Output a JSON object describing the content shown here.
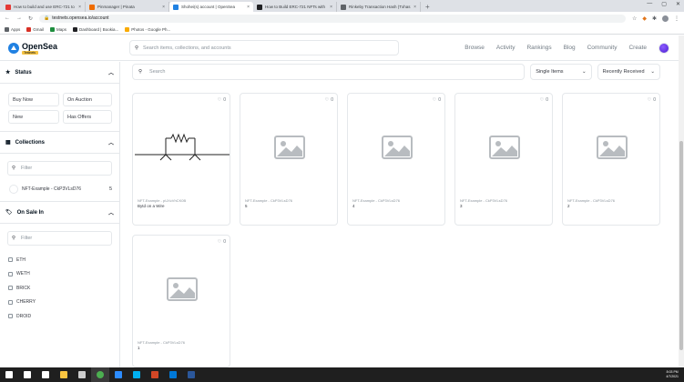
{
  "browser": {
    "tabs": [
      {
        "title": "How to build and use ERC-721 to",
        "color": "#e53935"
      },
      {
        "title": "Pinmanager | Pinata",
        "color": "#ef6c00"
      },
      {
        "title": "Shohei(s) account | OpenSea",
        "color": "#2081e2",
        "active": true
      },
      {
        "title": "How to Build ERC-721 NFTs with",
        "color": "#202124"
      },
      {
        "title": "Rinkeby Transaction Hash (Txhas",
        "color": "#5f6368"
      }
    ],
    "new_tab": "+",
    "url": "testnets.opensea.io/account",
    "bookmarks": [
      {
        "label": "Apps",
        "color": "#5f6368"
      },
      {
        "label": "Gmail",
        "color": "#d93025"
      },
      {
        "label": "Maps",
        "color": "#1e8e3e"
      },
      {
        "label": "Dashboard | Bookia...",
        "color": "#202124"
      },
      {
        "label": "Photos - Google Ph...",
        "color": "#f9ab00"
      }
    ]
  },
  "header": {
    "logo_name": "OpenSea",
    "logo_badge": "Testnets",
    "search_placeholder": "Search items, collections, and accounts",
    "nav": [
      "Browse",
      "Activity",
      "Rankings",
      "Blog",
      "Community",
      "Create"
    ]
  },
  "sidebar": {
    "status": {
      "title": "Status",
      "buttons": [
        "Buy Now",
        "On Auction",
        "New",
        "Has Offers"
      ]
    },
    "collections": {
      "title": "Collections",
      "filter_placeholder": "Filter",
      "items": [
        {
          "name": "NFT-Example - CkP3VLsD76",
          "count": "5"
        }
      ]
    },
    "on_sale": {
      "title": "On Sale In",
      "filter_placeholder": "Filter",
      "items": [
        "ETH",
        "WETH",
        "BRICK",
        "CHERRY",
        "DROID"
      ]
    }
  },
  "main": {
    "search_placeholder": "Search",
    "filter_select": "Single Items",
    "sort_select": "Recently Received",
    "cards": [
      {
        "collection": "NFT-Example - pUXcVhCK0B",
        "name": "Bytd on a Wire",
        "favorites": "0",
        "media": "circuit"
      },
      {
        "collection": "NFT-Example - CkP3VLsD76",
        "name": "5",
        "favorites": "0",
        "media": "placeholder"
      },
      {
        "collection": "NFT-Example - CkP3VLsD76",
        "name": "4",
        "favorites": "0",
        "media": "placeholder"
      },
      {
        "collection": "NFT-Example - CkP3VLsD76",
        "name": "3",
        "favorites": "0",
        "media": "placeholder"
      },
      {
        "collection": "NFT-Example - CkP3VLsD76",
        "name": "2",
        "favorites": "0",
        "media": "placeholder"
      },
      {
        "collection": "NFT-Example - CkP3VLsD76",
        "name": "1",
        "favorites": "0",
        "media": "placeholder"
      }
    ]
  },
  "taskbar": {
    "time": "8:03 PM",
    "date": "4/7/2021",
    "apps": [
      {
        "name": "windows-start",
        "color": "#ffffff"
      },
      {
        "name": "search",
        "color": "#ffffff"
      },
      {
        "name": "task-view",
        "color": "#ffffff"
      },
      {
        "name": "file-explorer",
        "color": "#f9c440"
      },
      {
        "name": "store",
        "color": "#cccccc"
      },
      {
        "name": "chrome",
        "color": "#4caf50",
        "active": true
      },
      {
        "name": "zoom",
        "color": "#2d8cff"
      },
      {
        "name": "skype",
        "color": "#00aff0"
      },
      {
        "name": "powerpoint",
        "color": "#d24726"
      },
      {
        "name": "vscode",
        "color": "#0078d7"
      },
      {
        "name": "word",
        "color": "#2b579a"
      }
    ]
  },
  "colors": {
    "accent": "#2081e2",
    "border": "#e5e8eb",
    "text": "#353840",
    "taskbar": "#1f1f1f"
  }
}
